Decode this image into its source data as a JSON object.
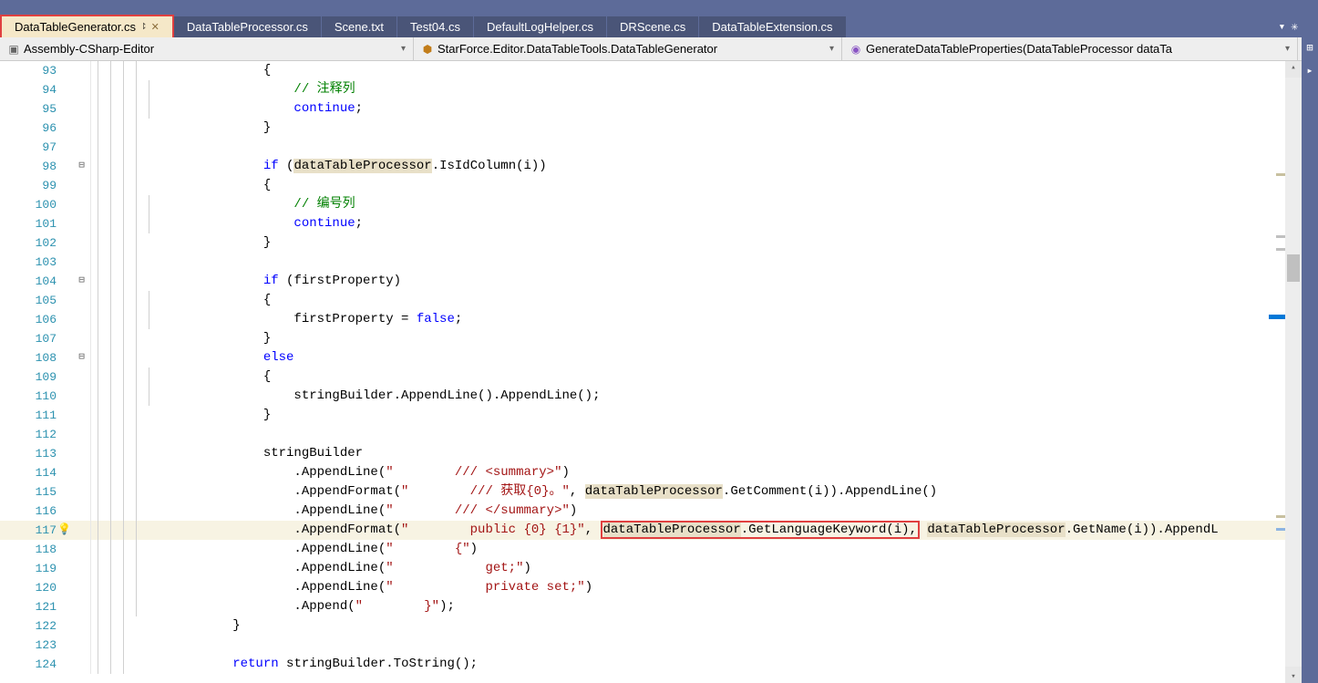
{
  "tabs": [
    {
      "label": "DataTableGenerator.cs",
      "active": true
    },
    {
      "label": "DataTableProcessor.cs"
    },
    {
      "label": "Scene.txt"
    },
    {
      "label": "Test04.cs"
    },
    {
      "label": "DefaultLogHelper.cs"
    },
    {
      "label": "DRScene.cs"
    },
    {
      "label": "DataTableExtension.cs"
    }
  ],
  "nav": {
    "project": "Assembly-CSharp-Editor",
    "class": "StarForce.Editor.DataTableTools.DataTableGenerator",
    "method": "GenerateDataTableProperties(DataTableProcessor dataTa"
  },
  "code": {
    "l93": "            {",
    "l94a": "                ",
    "l94b": "// 注释列",
    "l95a": "                ",
    "l95b": "continue",
    "l95c": ";",
    "l96": "            }",
    "l97": "",
    "l98a": "            ",
    "l98b": "if",
    "l98c": " (",
    "l98d": "dataTableProcessor",
    "l98e": ".IsIdColumn(i))",
    "l99": "            {",
    "l100a": "                ",
    "l100b": "// 编号列",
    "l101a": "                ",
    "l101b": "continue",
    "l101c": ";",
    "l102": "            }",
    "l103": "",
    "l104a": "            ",
    "l104b": "if",
    "l104c": " (firstProperty)",
    "l105": "            {",
    "l106a": "                firstProperty = ",
    "l106b": "false",
    "l106c": ";",
    "l107": "            }",
    "l108a": "            ",
    "l108b": "else",
    "l109": "            {",
    "l110": "                stringBuilder.AppendLine().AppendLine();",
    "l111": "            }",
    "l112": "",
    "l113": "            stringBuilder",
    "l114a": "                .AppendLine(",
    "l114b": "\"        /// <summary>\"",
    "l114c": ")",
    "l115a": "                .AppendFormat(",
    "l115b": "\"        /// 获取{0}。\"",
    "l115c": ", ",
    "l115d": "dataTableProcessor",
    "l115e": ".GetComment(i)).AppendLine()",
    "l116a": "                .AppendLine(",
    "l116b": "\"        /// </summary>\"",
    "l116c": ")",
    "l117a": "                .AppendFormat(",
    "l117b": "\"        public {0} {1}\"",
    "l117c": ", ",
    "l117d": "dataTableProcessor",
    "l117e": ".GetLanguageKeyword(i),",
    "l117f": " ",
    "l117g": "dataTableProcessor",
    "l117h": ".GetName(i)).AppendL",
    "l118a": "                .AppendLine(",
    "l118b": "\"        {\"",
    "l118c": ")",
    "l119a": "                .AppendLine(",
    "l119b": "\"            get;\"",
    "l119c": ")",
    "l120a": "                .AppendLine(",
    "l120b": "\"            private set;\"",
    "l120c": ")",
    "l121a": "                .Append(",
    "l121b": "\"        }\"",
    "l121c": ");",
    "l122": "        }",
    "l123": "",
    "l124a": "        ",
    "l124b": "return",
    "l124c": " stringBuilder.ToString();"
  },
  "linenos": [
    "93",
    "94",
    "95",
    "96",
    "97",
    "98",
    "99",
    "100",
    "101",
    "102",
    "103",
    "104",
    "105",
    "106",
    "107",
    "108",
    "109",
    "110",
    "111",
    "112",
    "113",
    "114",
    "115",
    "116",
    "117",
    "118",
    "119",
    "120",
    "121",
    "122",
    "123",
    "124"
  ]
}
